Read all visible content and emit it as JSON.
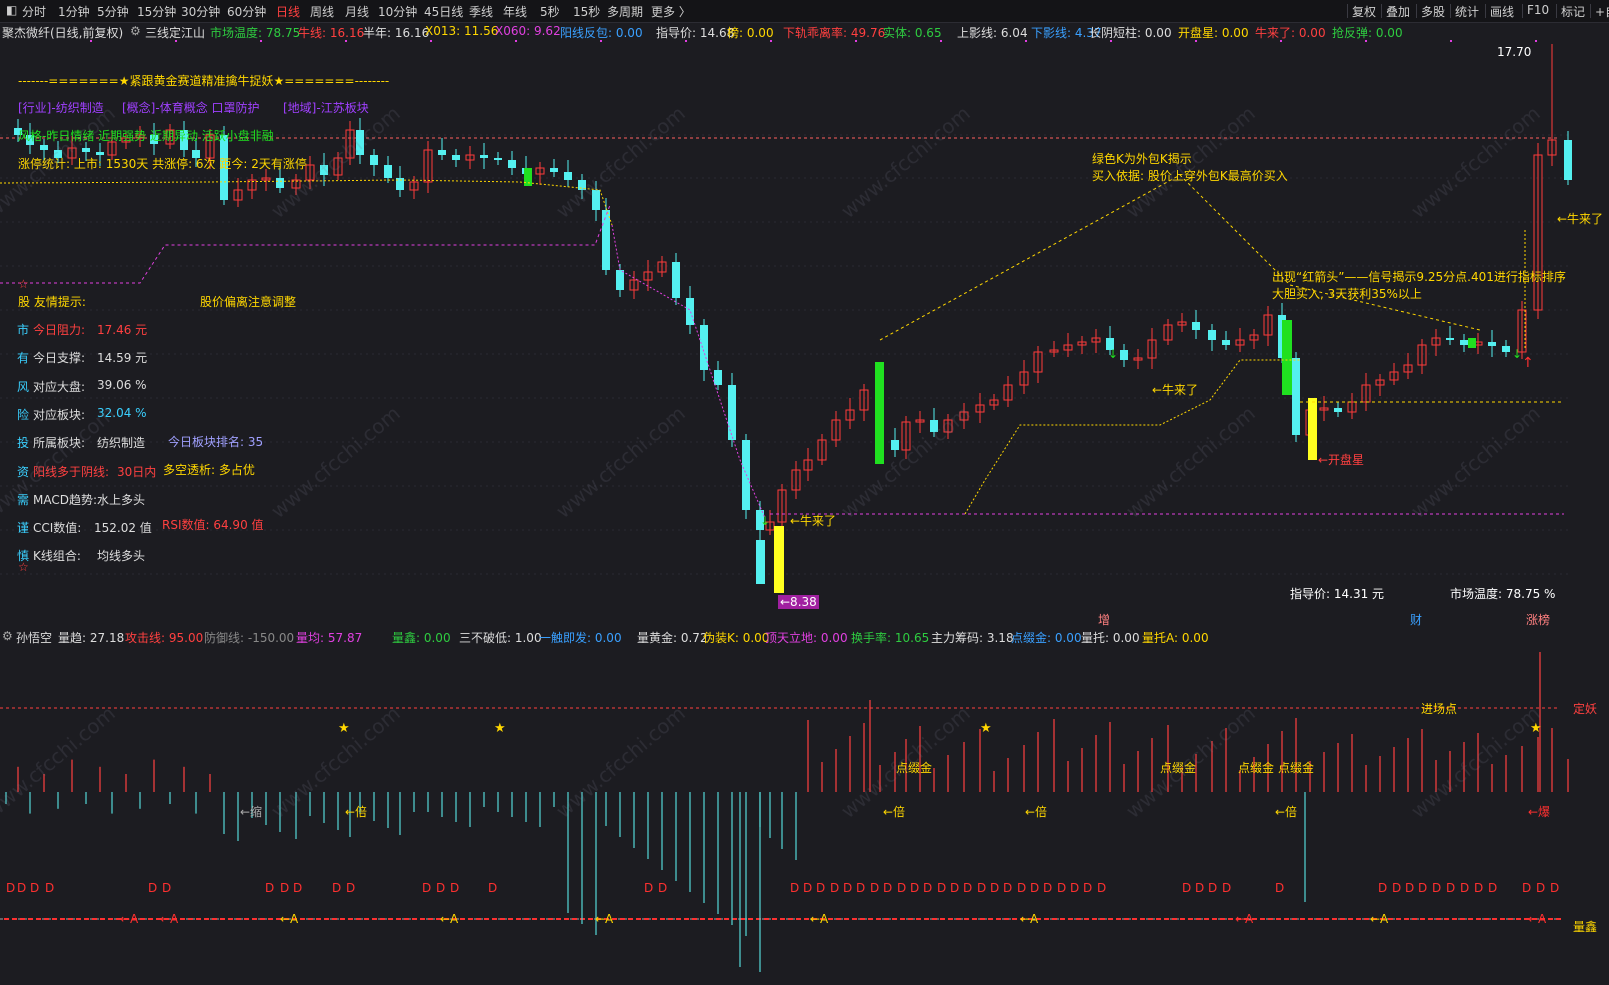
{
  "topbar": {
    "tabs": [
      "分时",
      "1分钟",
      "5分钟",
      "15分钟",
      "30分钟",
      "60分钟",
      "日线",
      "周线",
      "月线",
      "10分钟",
      "45日线",
      "季线",
      "年线",
      "5秒",
      "15秒",
      "多周期",
      "更多 〉"
    ],
    "active": "日线",
    "right": [
      "复权",
      "叠加",
      "多股",
      "统计",
      "画线",
      "F10",
      "标记",
      "+自"
    ]
  },
  "header": {
    "stock": "聚杰微纤(日线,前复权)",
    "indicator": "三线定江山",
    "items": [
      {
        "label": "市场温度: 78.75",
        "color": "#2ecc40"
      },
      {
        "label": "牛线: 16.16",
        "color": "#ff4040"
      },
      {
        "label": "半年: 16.16",
        "color": "#dddddd"
      },
      {
        "label": "X013: 11.56",
        "color": "#ffd700"
      },
      {
        "label": "X060: 9.62",
        "color": "#e040e0"
      },
      {
        "label": "阳线反包: 0.00",
        "color": "#3aa0ff"
      },
      {
        "label": "指导价: 14.68",
        "color": "#dddddd"
      },
      {
        "label": "榜: 0.00",
        "color": "#ffd700"
      },
      {
        "label": "下轨乖离率: 49.76",
        "color": "#ff4040"
      },
      {
        "label": "实体: 0.65",
        "color": "#2ecc40"
      },
      {
        "label": "上影线: 6.04",
        "color": "#dddddd"
      },
      {
        "label": "下影线: 4.37",
        "color": "#3aa0ff"
      },
      {
        "label": "长阴短柱: 0.00",
        "color": "#dddddd"
      },
      {
        "label": "开盘星: 0.00",
        "color": "#ffd700"
      },
      {
        "label": "牛来了: 0.00",
        "color": "#ff4040"
      },
      {
        "label": "抢反弹: 0.00",
        "color": "#2ecc40"
      }
    ]
  },
  "overlay": {
    "banner": "-------=======★紧跟黄金赛道精准擒牛捉妖★=======--------",
    "tags": [
      "[行业]-纺织制造",
      "[概念]-体育概念 口罩防护",
      "[地域]-江苏板块"
    ],
    "style": "风格-昨日情绪 近期强势 近期异动 活跃小盘非融",
    "limit_stats": "涨停统计: 上市: 1530天 共涨停: 6次 距今: 2天有涨停",
    "friendly_tip": "股 友情提示:",
    "deviation": "股价偏离注意调整",
    "info": [
      {
        "prefix": "市",
        "text": "今日阻力:",
        "value": "17.46 元",
        "color": "#ff4040"
      },
      {
        "prefix": "有",
        "text": "今日支撑:",
        "value": "14.59 元",
        "color": "#dddddd"
      },
      {
        "prefix": "风",
        "text": "对应大盘:",
        "value": "39.06 %",
        "color": "#dddddd"
      },
      {
        "prefix": "险",
        "text": "对应板块:",
        "value": "32.04 %",
        "color": "#3ad0ff"
      },
      {
        "prefix": "投",
        "text": "所属板块:",
        "value": "纺织制造",
        "color": "#dddddd"
      },
      {
        "prefix": "资",
        "text": "阳线多于阴线:",
        "value": "30日内",
        "color": "#ff4040"
      },
      {
        "prefix": "需",
        "text": "MACD趋势:",
        "value": "水上多头",
        "color": "#dddddd"
      },
      {
        "prefix": "谨",
        "text": "CCI数值:",
        "value": "152.02 值",
        "color": "#dddddd"
      },
      {
        "prefix": "慎",
        "text": "K线组合:",
        "value": "均线多头",
        "color": "#dddddd"
      }
    ],
    "board_rank": "今日板块排名: 35",
    "long_short": "多空透析: 多占优",
    "rsi": "RSI数值: 64.90 值",
    "outer_k_title": "绿色K为外包K揭示",
    "outer_k_basis": "买入依据: 股价上穿外包K最高价买入",
    "red_arrow_line1": "出现“红箭头”——信号揭示9.25分点.401进行指标排序",
    "red_arrow_line2": "大胆买入, 3天获利35%以上",
    "bull1": "←牛来了",
    "bull2": "←牛来了",
    "bull3": "←牛来了",
    "open_star": "←开盘星",
    "low_price": "←8.38",
    "high_price": "17.70",
    "guide_price": "指导价: 14.31 元",
    "market_temp": "市场温度: 78.75 %",
    "bottom_marks": [
      "增",
      "财",
      "涨榜"
    ]
  },
  "sub": {
    "name": "孙悟空",
    "items": [
      {
        "label": "量趋: 27.18",
        "color": "#dddddd"
      },
      {
        "label": "攻击线: 95.00",
        "color": "#ff4040"
      },
      {
        "label": "防御线: -150.00",
        "color": "#888888"
      },
      {
        "label": "量均: 57.87",
        "color": "#e040e0"
      },
      {
        "label": "量鑫: 0.00",
        "color": "#2ecc40"
      },
      {
        "label": "三不破低: 1.00",
        "color": "#dddddd"
      },
      {
        "label": "一触即发: 0.00",
        "color": "#3aa0ff"
      },
      {
        "label": "量黄金: 0.72",
        "color": "#dddddd"
      },
      {
        "label": "伪装K: 0.00",
        "color": "#ffd700"
      },
      {
        "label": "顶天立地: 0.00",
        "color": "#e040e0"
      },
      {
        "label": "换手率: 10.65",
        "color": "#2ecc40"
      },
      {
        "label": "主力筹码: 3.18",
        "color": "#dddddd"
      },
      {
        "label": "点缀金: 0.00",
        "color": "#3aa0ff"
      },
      {
        "label": "量托: 0.00",
        "color": "#dddddd"
      },
      {
        "label": "量托A: 0.00",
        "color": "#ffd700"
      }
    ],
    "entry_point": "进场点",
    "fix_demon": "定妖",
    "liang_xin": "量鑫",
    "shrink": "←缩",
    "double": "←倍",
    "burst": "←爆",
    "dot_gold": "点缀金",
    "d_mark": "D",
    "a_mark": "←A"
  },
  "watermark": "www.cfcchi.com",
  "colors": {
    "up": "#ff3b3b",
    "down": "#54f0f0",
    "green": "#20e020",
    "yellow": "#ffff20",
    "bg": "#1c1c21"
  }
}
